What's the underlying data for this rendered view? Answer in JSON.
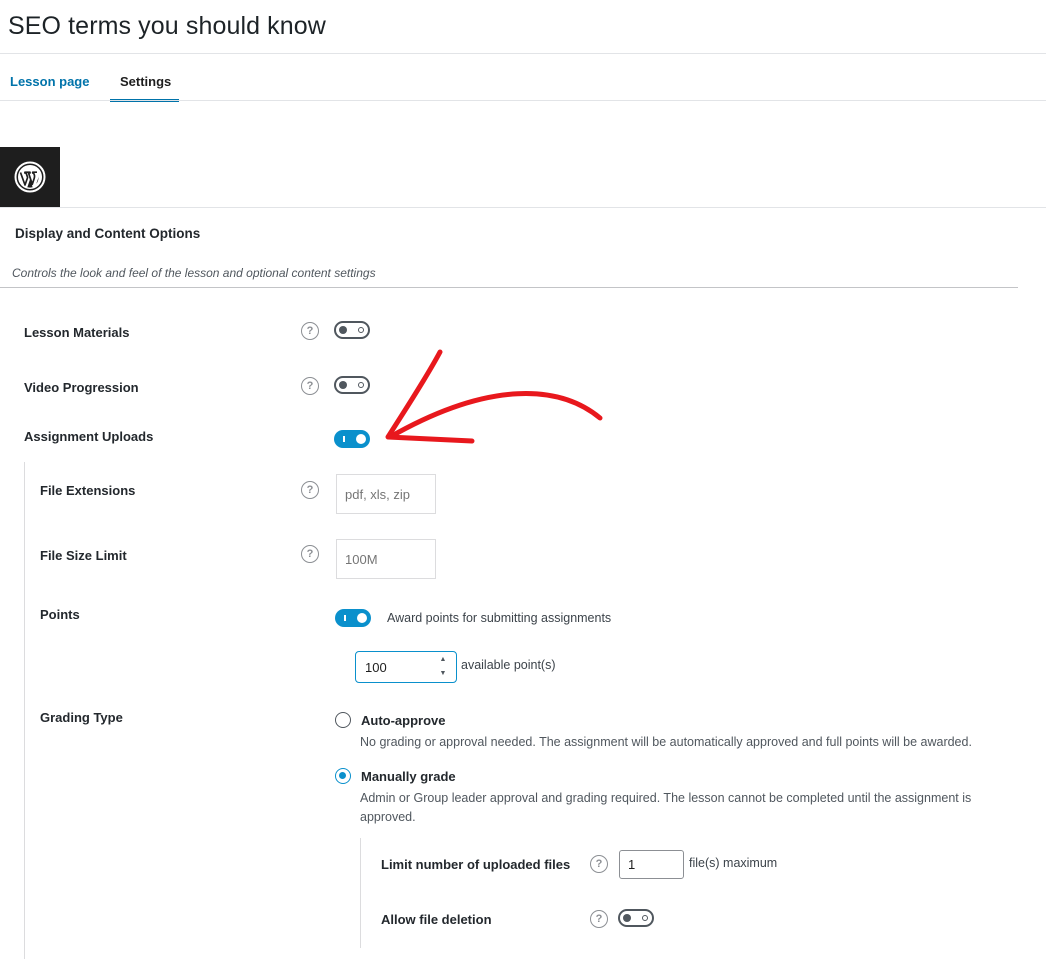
{
  "page": {
    "title": "SEO terms you should know",
    "tabs": [
      {
        "label": "Lesson page",
        "active": false
      },
      {
        "label": "Settings",
        "active": true
      }
    ]
  },
  "section": {
    "title": "Display and Content Options",
    "description": "Controls the look and feel of the lesson and optional content settings"
  },
  "settings": {
    "lesson_materials": {
      "label": "Lesson Materials",
      "enabled": false
    },
    "video_progression": {
      "label": "Video Progression",
      "enabled": false
    },
    "assignment_uploads": {
      "label": "Assignment Uploads",
      "enabled": true
    },
    "file_extensions": {
      "label": "File Extensions",
      "placeholder": "pdf, xls, zip"
    },
    "file_size_limit": {
      "label": "File Size Limit",
      "placeholder": "100M"
    },
    "points": {
      "label": "Points",
      "toggle_label": "Award points for submitting assignments",
      "enabled": true,
      "value": "100",
      "suffix": "available point(s)"
    },
    "grading_type": {
      "label": "Grading Type",
      "options": [
        {
          "label": "Auto-approve",
          "description": "No grading or approval needed. The assignment will be automatically approved and full points will be awarded.",
          "selected": false
        },
        {
          "label": "Manually grade",
          "description_line1": "Admin or Group leader approval and grading required. The lesson cannot be completed until the assignment is",
          "description_line2": "approved.",
          "selected": true
        }
      ]
    },
    "limit_uploaded_files": {
      "label": "Limit number of uploaded files",
      "value": "1",
      "suffix": "file(s) maximum"
    },
    "allow_file_deletion": {
      "label": "Allow file deletion",
      "enabled": false
    }
  },
  "help_glyph": "?",
  "colors": {
    "accent": "#0a90cc",
    "annotation": "#e8181d",
    "tab_link": "#0073aa"
  }
}
